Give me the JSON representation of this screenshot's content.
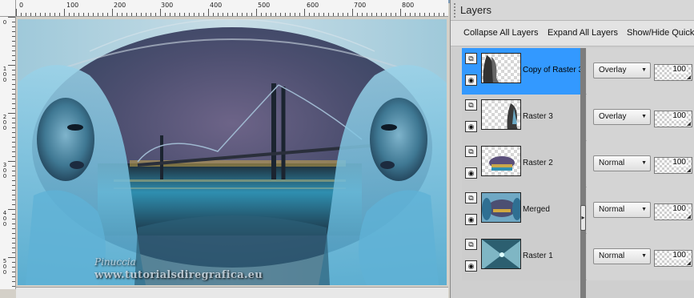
{
  "ruler": {
    "top_labels": [
      "0",
      "100",
      "200",
      "300",
      "400",
      "500",
      "600",
      "700",
      "800"
    ],
    "left_labels": [
      "0",
      "100",
      "200",
      "300",
      "400",
      "500"
    ]
  },
  "canvas": {
    "watermark_logo": "Pinuccia",
    "watermark_text": "www.tutorialsdiregrafica.eu"
  },
  "panel": {
    "title": "Layers",
    "toolbar": {
      "collapse_all": "Collapse All Layers",
      "expand_all": "Expand All Layers",
      "show_hide": "Show/Hide Quick"
    }
  },
  "layers": [
    {
      "name": "Copy of Raster 3",
      "blend": "Overlay",
      "opacity": "100",
      "selected": true,
      "thumb": "figures-dark"
    },
    {
      "name": "Raster 3",
      "blend": "Overlay",
      "opacity": "100",
      "selected": false,
      "thumb": "figure-right"
    },
    {
      "name": "Raster 2",
      "blend": "Normal",
      "opacity": "100",
      "selected": false,
      "thumb": "bridge-small"
    },
    {
      "name": "Merged",
      "blend": "Normal",
      "opacity": "100",
      "selected": false,
      "thumb": "merged-full"
    },
    {
      "name": "Raster 1",
      "blend": "Normal",
      "opacity": "100",
      "selected": false,
      "thumb": "radial-teal"
    }
  ],
  "icons": {
    "layer_type": "layer-stack-icon",
    "visibility": "eye-icon",
    "dropdown": "chevron-down-icon",
    "divider_handle": "chevron-right-icon"
  },
  "colors": {
    "selection": "#3399ff",
    "panel_bg": "#cfcfcf",
    "divider": "#7d7d7d"
  }
}
